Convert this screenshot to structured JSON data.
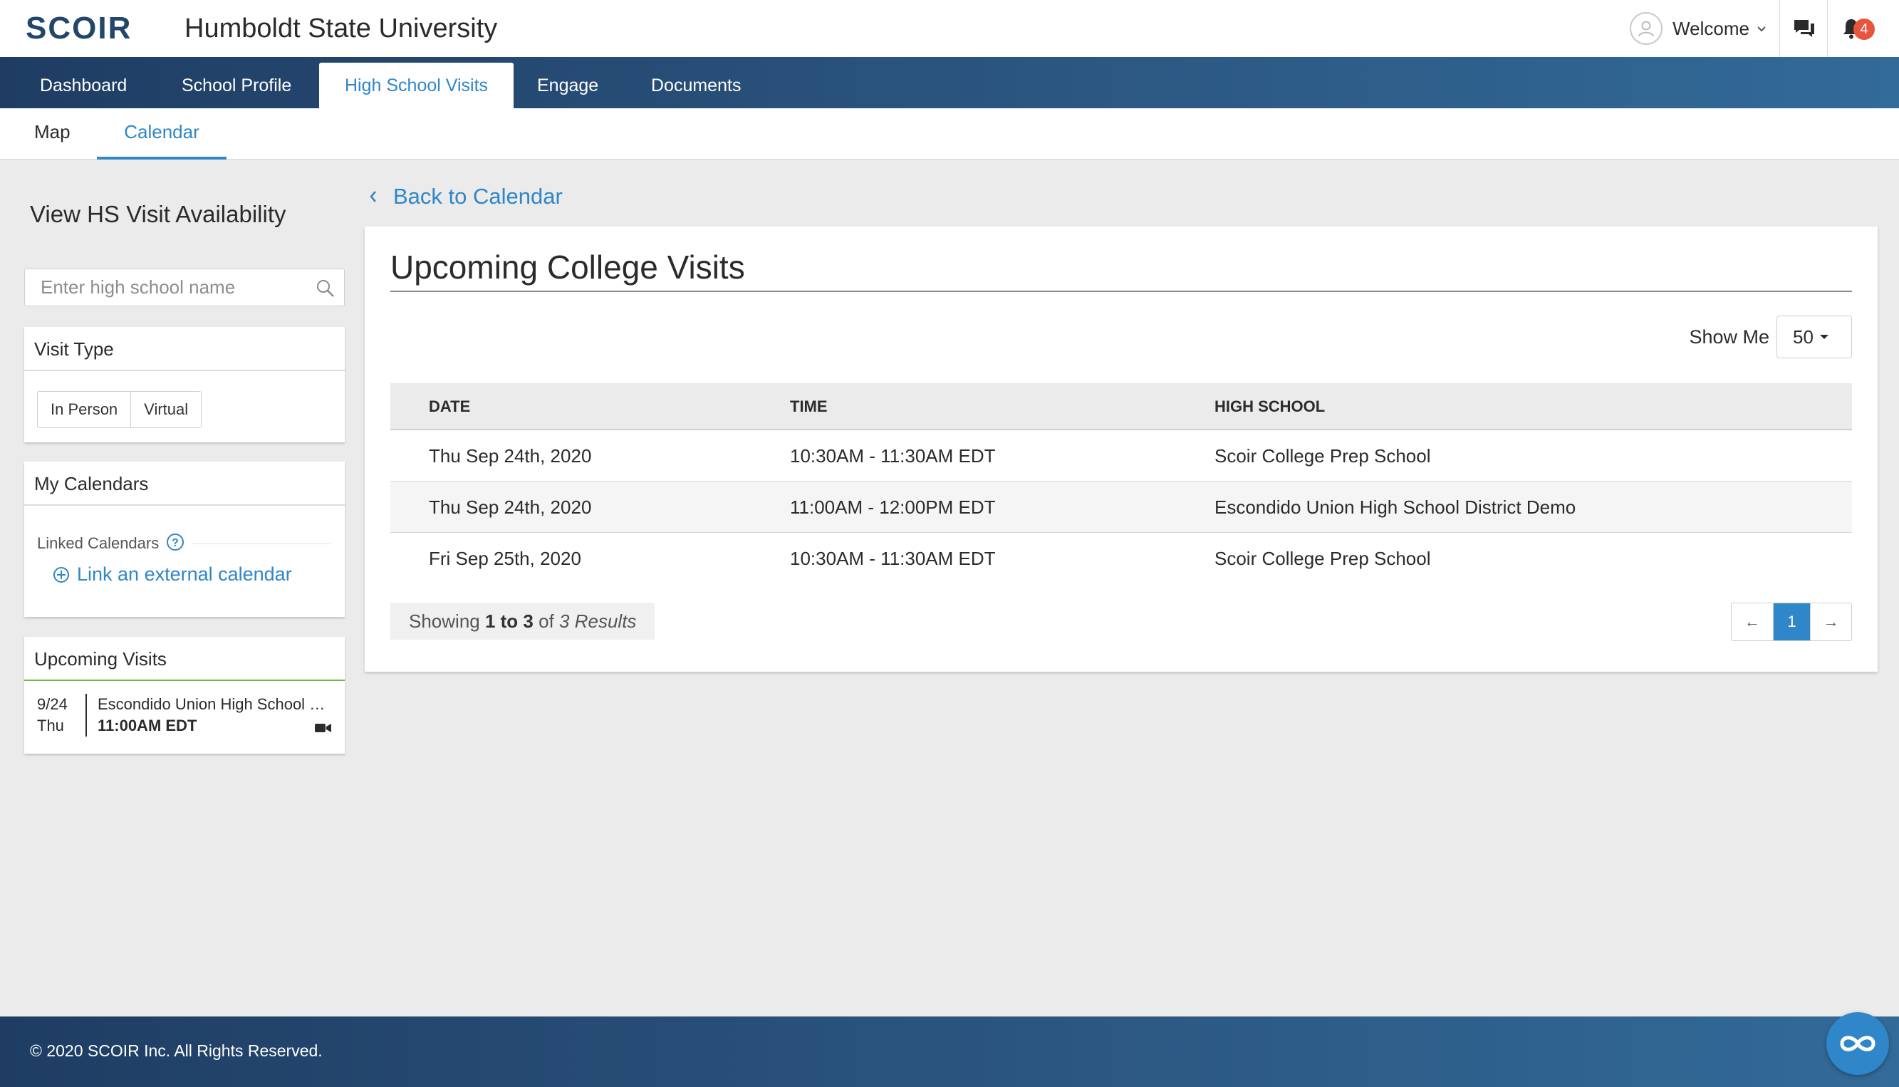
{
  "brand": {
    "logo": "SCOIR",
    "school": "Humboldt State University",
    "accent": "#2f86c8",
    "nav_color": "#23466b"
  },
  "header": {
    "welcome": "Welcome",
    "notification_count": "4"
  },
  "main_nav": {
    "tabs": [
      "Dashboard",
      "School Profile",
      "High School Visits",
      "Engage",
      "Documents"
    ],
    "active": "High School Visits"
  },
  "sub_nav": {
    "tabs": [
      "Map",
      "Calendar"
    ],
    "active": "Calendar"
  },
  "sidebar": {
    "title": "View HS Visit Availability",
    "search_placeholder": "Enter high school name",
    "visit_type": {
      "heading": "Visit Type",
      "options": [
        "In Person",
        "Virtual"
      ]
    },
    "my_calendars": {
      "heading": "My Calendars",
      "linked_label": "Linked Calendars",
      "link_text": "Link an external calendar"
    },
    "upcoming": {
      "heading": "Upcoming Visits",
      "items": [
        {
          "date": "9/24",
          "day": "Thu",
          "school": "Escondido Union High School District Demo",
          "time": "11:00AM EDT"
        }
      ]
    }
  },
  "main": {
    "back_link": "Back to Calendar",
    "title": "Upcoming College Visits",
    "show_me_label": "Show Me",
    "show_me_value": "50",
    "columns": [
      "DATE",
      "TIME",
      "HIGH SCHOOL"
    ],
    "rows": [
      {
        "date": "Thu Sep 24th, 2020",
        "time": "10:30AM - 11:30AM EDT",
        "school": "Scoir College Prep School"
      },
      {
        "date": "Thu Sep 24th, 2020",
        "time": "11:00AM - 12:00PM EDT",
        "school": "Escondido Union High School District Demo"
      },
      {
        "date": "Fri Sep 25th, 2020",
        "time": "10:30AM - 11:30AM EDT",
        "school": "Scoir College Prep School"
      }
    ],
    "showing": {
      "prefix": "Showing",
      "range": "1 to 3",
      "of": "of",
      "results": "3 Results"
    },
    "pager": {
      "prev": "←",
      "current": "1",
      "next": "→"
    }
  },
  "footer": {
    "copyright": "© 2020 SCOIR Inc. All Rights Reserved."
  }
}
